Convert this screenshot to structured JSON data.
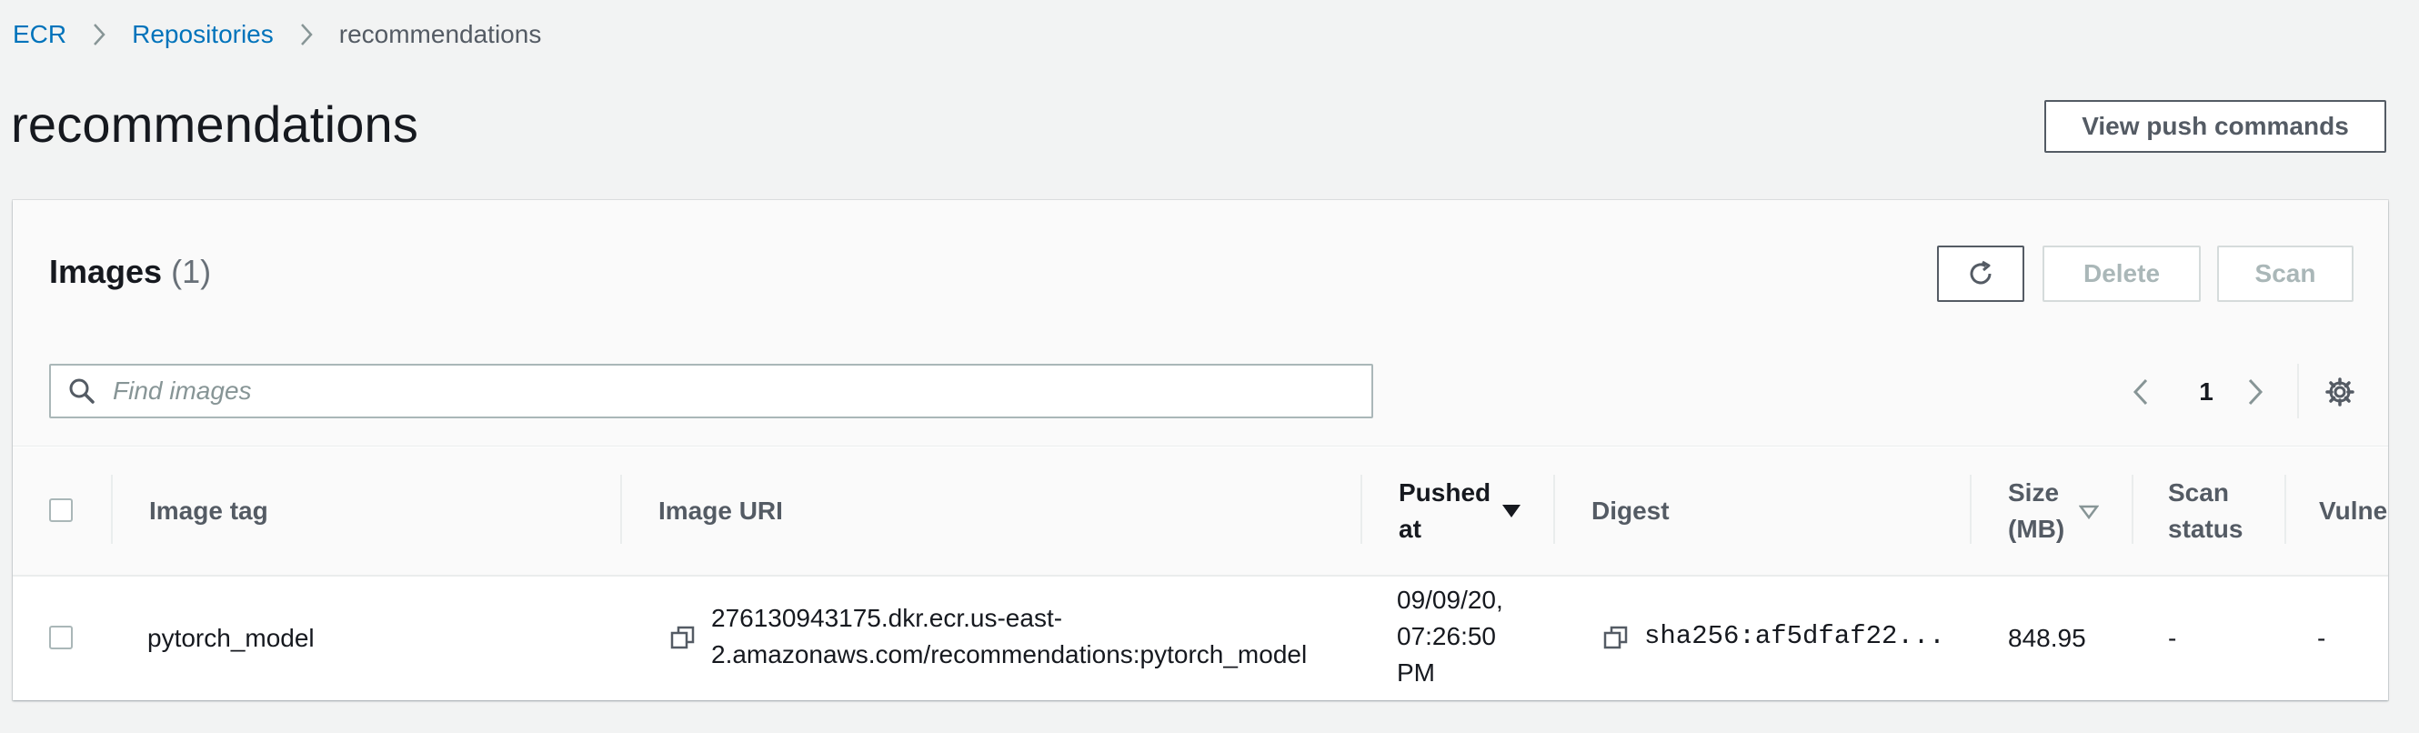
{
  "breadcrumb": {
    "items": [
      {
        "label": "ECR"
      },
      {
        "label": "Repositories"
      }
    ],
    "current": "recommendations"
  },
  "page": {
    "title": "recommendations",
    "push_button": "View push commands"
  },
  "images_panel": {
    "heading": "Images",
    "count": "(1)",
    "actions": {
      "delete": "Delete",
      "scan": "Scan"
    },
    "search": {
      "placeholder": "Find images",
      "value": ""
    },
    "pagination": {
      "current_page": "1"
    }
  },
  "table": {
    "headers": {
      "image_tag": "Image tag",
      "image_uri": "Image URI",
      "pushed_at_1": "Pushed",
      "pushed_at_2": "at",
      "digest": "Digest",
      "size_1": "Size",
      "size_2": "(MB)",
      "scan_status_1": "Scan",
      "scan_status_2": "status",
      "vulnerabilities": "Vulne"
    },
    "rows": [
      {
        "image_tag": "pytorch_model",
        "image_uri_1": "276130943175.dkr.ecr.us-east-",
        "image_uri_2": "2.amazonaws.com/recommendations:pytorch_model",
        "pushed_at_1": "09/09/20,",
        "pushed_at_2": "07:26:50",
        "pushed_at_3": "PM",
        "digest": "sha256:af5dfaf22...",
        "size": "848.95",
        "scan_status": "-",
        "vulnerabilities": "-"
      }
    ]
  },
  "colors": {
    "link": "#0073bb",
    "background": "#f2f3f3",
    "text": "#16191f",
    "muted": "#545b64",
    "disabled": "#aab7b8"
  },
  "icons": {
    "refresh": "refresh-icon",
    "search": "search-icon",
    "prev": "chevron-left-icon",
    "next": "chevron-right-icon",
    "settings": "gear-icon",
    "copy": "copy-icon",
    "sort_desc": "caret-down-icon"
  }
}
